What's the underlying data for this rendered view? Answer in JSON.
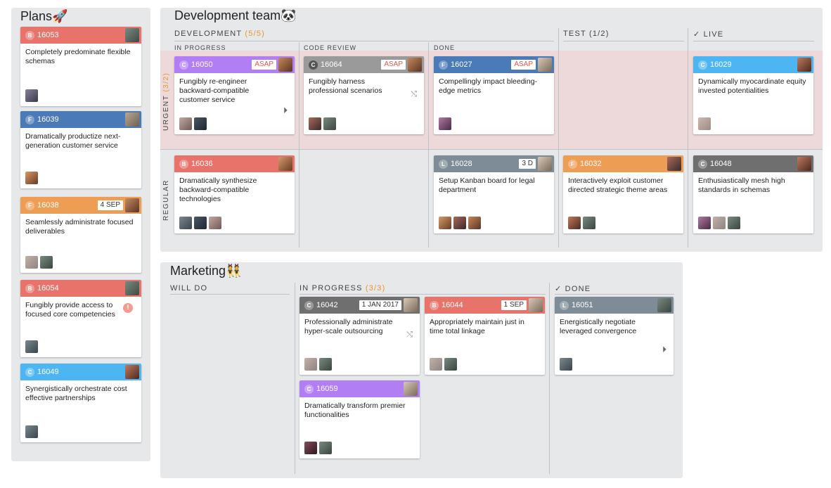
{
  "colors": {
    "accent": "#e8962f",
    "urgent_lane": "#edd9d9",
    "panel": "#e6e8ea"
  },
  "plans": {
    "title": "Plans🚀",
    "cards": [
      {
        "type": "B",
        "id": "16053",
        "text": "Completely predominate flexible schemas"
      },
      {
        "type": "F",
        "id": "16039",
        "text": "Dramatically productize next-generation customer service"
      },
      {
        "type": "F",
        "id": "16038",
        "tag": "4 SEP",
        "text": "Seamlessly administrate focused deliverables"
      },
      {
        "type": "B",
        "id": "16054",
        "text": "Fungibly provide access to focused core competencies",
        "alert": "!"
      },
      {
        "type": "C",
        "id": "16049",
        "text": "Synergistically orchestrate cost effective partnerships"
      }
    ]
  },
  "dev": {
    "title": "Development team🐼",
    "development": {
      "label": "DEVELOPMENT",
      "count": "(5/5)"
    },
    "test": {
      "label": "TEST (1/2)"
    },
    "live": {
      "label": "✓ LIVE"
    },
    "sub": {
      "in_progress": "IN PROGRESS",
      "code_review": "CODE REVIEW",
      "done": "DONE"
    },
    "lanes": {
      "urgent": "URGENT",
      "urgent_count": "(3/2)",
      "regular": "REGULAR"
    },
    "cards": [
      {
        "type": "C",
        "id": "16050",
        "tag": "ASAP",
        "text": "Fungibly re-engineer backward-compatible customer service"
      },
      {
        "type": "C",
        "id": "16064",
        "tag": "ASAP",
        "text": "Fungibly harness professional scenarios"
      },
      {
        "type": "F",
        "id": "16027",
        "tag": "ASAP",
        "text": "Compellingly impact bleeding-edge metrics"
      },
      {
        "type": "C",
        "id": "16029",
        "text": "Dynamically myocardinate equity invested potentialities"
      },
      {
        "type": "B",
        "id": "16036",
        "text": "Dramatically synthesize backward-compatible technologies"
      },
      {
        "type": "L",
        "id": "16028",
        "tag": "3 D",
        "text": "Setup Kanban board for legal department"
      },
      {
        "type": "F",
        "id": "16032",
        "text": "Interactively exploit customer directed strategic theme areas"
      },
      {
        "type": "C",
        "id": "16048",
        "text": "Enthusiastically mesh high standards in schemas"
      }
    ]
  },
  "mkt": {
    "title": "Marketing👯",
    "will_do": "WILL DO",
    "in_progress": {
      "label": "IN PROGRESS",
      "count": "(3/3)"
    },
    "done": "✓ DONE",
    "cards": [
      {
        "type": "C",
        "id": "16042",
        "tag": "1 JAN 2017",
        "text": "Professionally administrate hyper-scale outsourcing"
      },
      {
        "type": "B",
        "id": "16044",
        "tag": "1 SEP",
        "text": "Appropriately maintain just in time total linkage"
      },
      {
        "type": "L",
        "id": "16051",
        "text": "Energistically negotiate leveraged convergence"
      },
      {
        "type": "C",
        "id": "16059",
        "text": "Dramatically transform premier functionalities"
      }
    ]
  }
}
